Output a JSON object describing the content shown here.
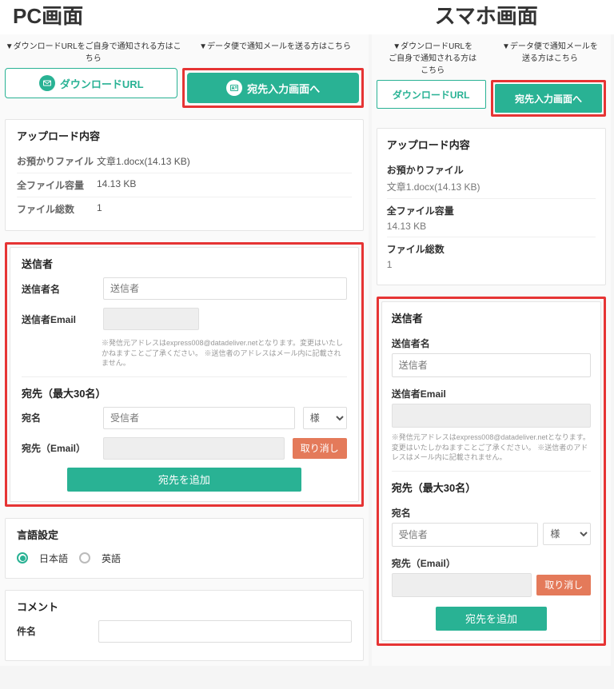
{
  "titles": {
    "pc": "PC画面",
    "sp": "スマホ画面"
  },
  "hints": {
    "download": "▼ダウンロードURLをご自身で通知される方はこちら",
    "send": "▼データ便で通知メールを送る方はこちら",
    "download_sp": "▼ダウンロードURLを\nご自身で通知される方は\nこちら",
    "send_sp": "▼データ便で通知メールを\n送る方はこちら"
  },
  "buttons": {
    "download_url": "ダウンロードURL",
    "to_recipients": "宛先入力画面へ",
    "add_recipient": "宛先を追加",
    "cancel": "取り消し"
  },
  "upload": {
    "title": "アップロード内容",
    "file_label": "お預かりファイル",
    "file_val": "文章1.docx(14.13 KB)",
    "size_label": "全ファイル容量",
    "size_val": "14.13 KB",
    "count_label": "ファイル総数",
    "count_val": "1"
  },
  "sender": {
    "title": "送信者",
    "name_label": "送信者名",
    "name_placeholder": "送信者",
    "email_label": "送信者Email",
    "note": "※発信元アドレスはexpress008@datadeliver.netとなります。変更はいたしかねますことご了承ください。\n※送信者のアドレスはメール内に記載されません。"
  },
  "recipients": {
    "title": "宛先（最大30名）",
    "name_label": "宛名",
    "name_placeholder": "受信者",
    "honorific": "様",
    "email_label": "宛先（Email）"
  },
  "language": {
    "title": "言語設定",
    "ja": "日本語",
    "en": "英語"
  },
  "comment": {
    "title": "コメント",
    "subject_label": "件名"
  }
}
